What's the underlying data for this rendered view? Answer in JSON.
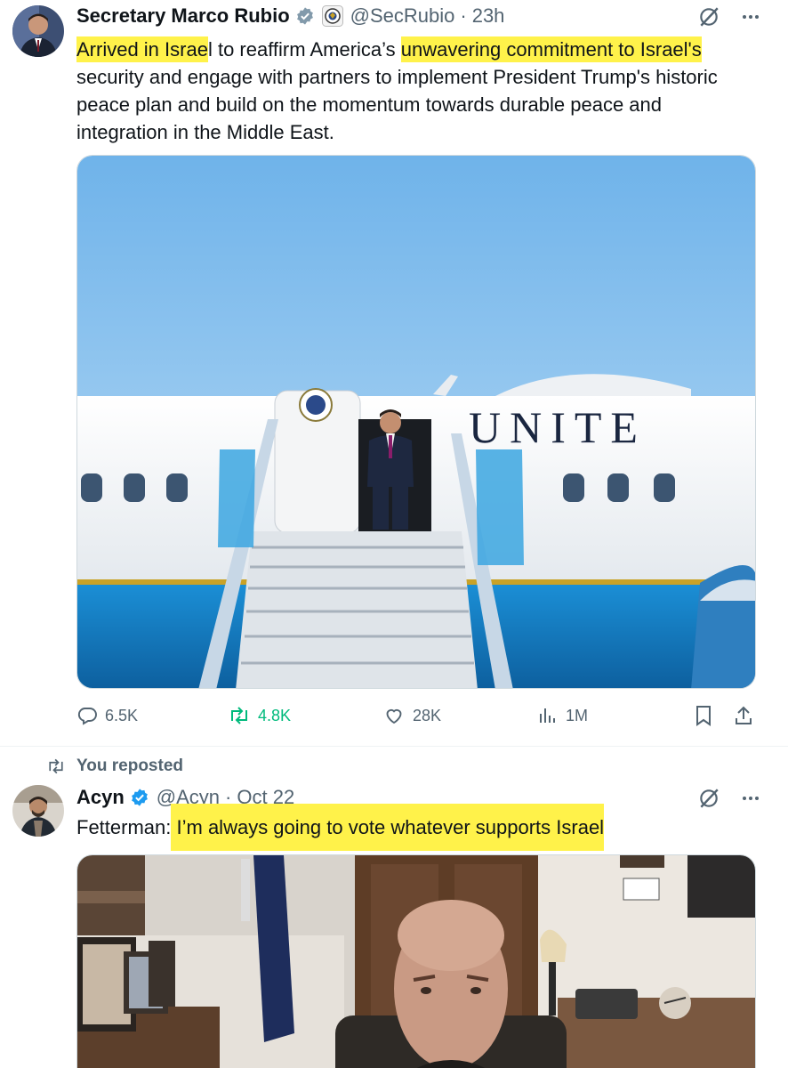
{
  "tweet1": {
    "author_name": "Secretary Marco Rubio",
    "handle": "@SecRubio",
    "dot": "·",
    "time": "23h",
    "text_segments": [
      {
        "text": "Arrived in Israe",
        "highlight": true
      },
      {
        "text": "l to reaffirm America’s ",
        "highlight": false
      },
      {
        "text": "unwavering commitment to Israel's",
        "highlight": true
      },
      {
        "text": " security and engage with partners to implement President Trump's historic peace plan and build on the momentum towards durable peace and integration in the Middle East.",
        "highlight": false
      }
    ],
    "image_text": "UNITE",
    "stats": {
      "replies": "6.5K",
      "reposts": "4.8K",
      "likes": "28K",
      "views": "1M"
    }
  },
  "repost_banner": {
    "label": "You reposted"
  },
  "tweet2": {
    "author_name": "Acyn",
    "handle": "@Acyn",
    "dot": "·",
    "time": "Oct 22",
    "text_prefix": "Fetterman",
    "text_colon": ":",
    "text_highlight": " I’m always going to vote whatever supports Israel "
  },
  "colors": {
    "accent_blue": "#1d9bf0",
    "repost_green": "#00ba7c",
    "highlight_yellow": "#fff24a",
    "secondary_text": "#536471"
  },
  "icons": [
    "verified-badge-icon",
    "gov-seal-icon",
    "grok-icon",
    "more-icon",
    "reply-icon",
    "repost-icon",
    "like-icon",
    "views-icon",
    "bookmark-icon",
    "share-icon"
  ]
}
